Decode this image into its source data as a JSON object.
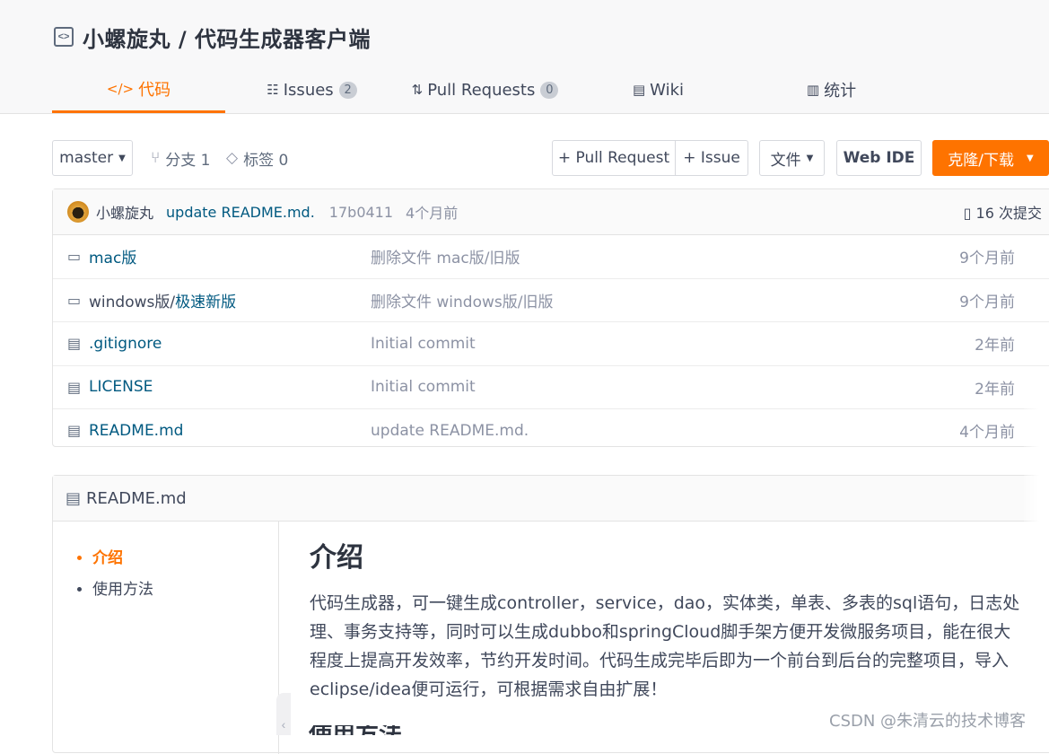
{
  "repo": {
    "title": "小螺旋丸 / 代码生成器客户端",
    "icon": "code-brackets-icon"
  },
  "tabs": [
    {
      "label": "代码",
      "icon": "code-icon",
      "active": true
    },
    {
      "label": "Issues",
      "icon": "issues-icon",
      "count": "2"
    },
    {
      "label": "Pull Requests",
      "icon": "pull-request-icon",
      "count": "0"
    },
    {
      "label": "Wiki",
      "icon": "wiki-book-icon"
    },
    {
      "label": "统计",
      "icon": "bar-chart-icon"
    }
  ],
  "toolbar": {
    "branch": "master",
    "branches": "分支 1",
    "tags": "标签 0",
    "pull_request": "+ Pull Request",
    "issue": "+ Issue",
    "file": "文件",
    "web_ide": "Web IDE",
    "clone": "克隆/下载"
  },
  "commit": {
    "author": "小螺旋丸",
    "message": "update README.md.",
    "hash": "17b0411",
    "time": "4个月前",
    "count": "16 次提交"
  },
  "files": [
    {
      "name": "mac版",
      "type": "folder",
      "message": "删除文件 mac版/旧版",
      "time": "9个月前"
    },
    {
      "name_dir": "windows版/",
      "name": "极速新版",
      "type": "folder",
      "message": "删除文件 windows版/旧版",
      "time": "9个月前"
    },
    {
      "name": ".gitignore",
      "type": "file",
      "message": "Initial commit",
      "time": "2年前"
    },
    {
      "name": "LICENSE",
      "type": "file",
      "message": "Initial commit",
      "time": "2年前"
    },
    {
      "name": "README.md",
      "type": "file",
      "message": "update README.md.",
      "time": "4个月前"
    }
  ],
  "readme": {
    "title": "README.md",
    "toc": [
      "介绍",
      "使用方法"
    ],
    "heading": "介绍",
    "paragraph": "代码生成器，可一键生成controller，service，dao，实体类，单表、多表的sql语句，日志处理、事务支持等，同时可以生成dubbo和springCloud脚手架方便开发微服务项目，能在很大程度上提高开发效率，节约开发时间。代码生成完毕后即为一个前台到后台的完整项目，导入eclipse/idea便可运行，可根据需求自由扩展！",
    "next_heading": "使用方法"
  },
  "watermark": "CSDN @朱清云的技术博客",
  "colors": {
    "accent": "#fe7300",
    "link": "#005980"
  }
}
